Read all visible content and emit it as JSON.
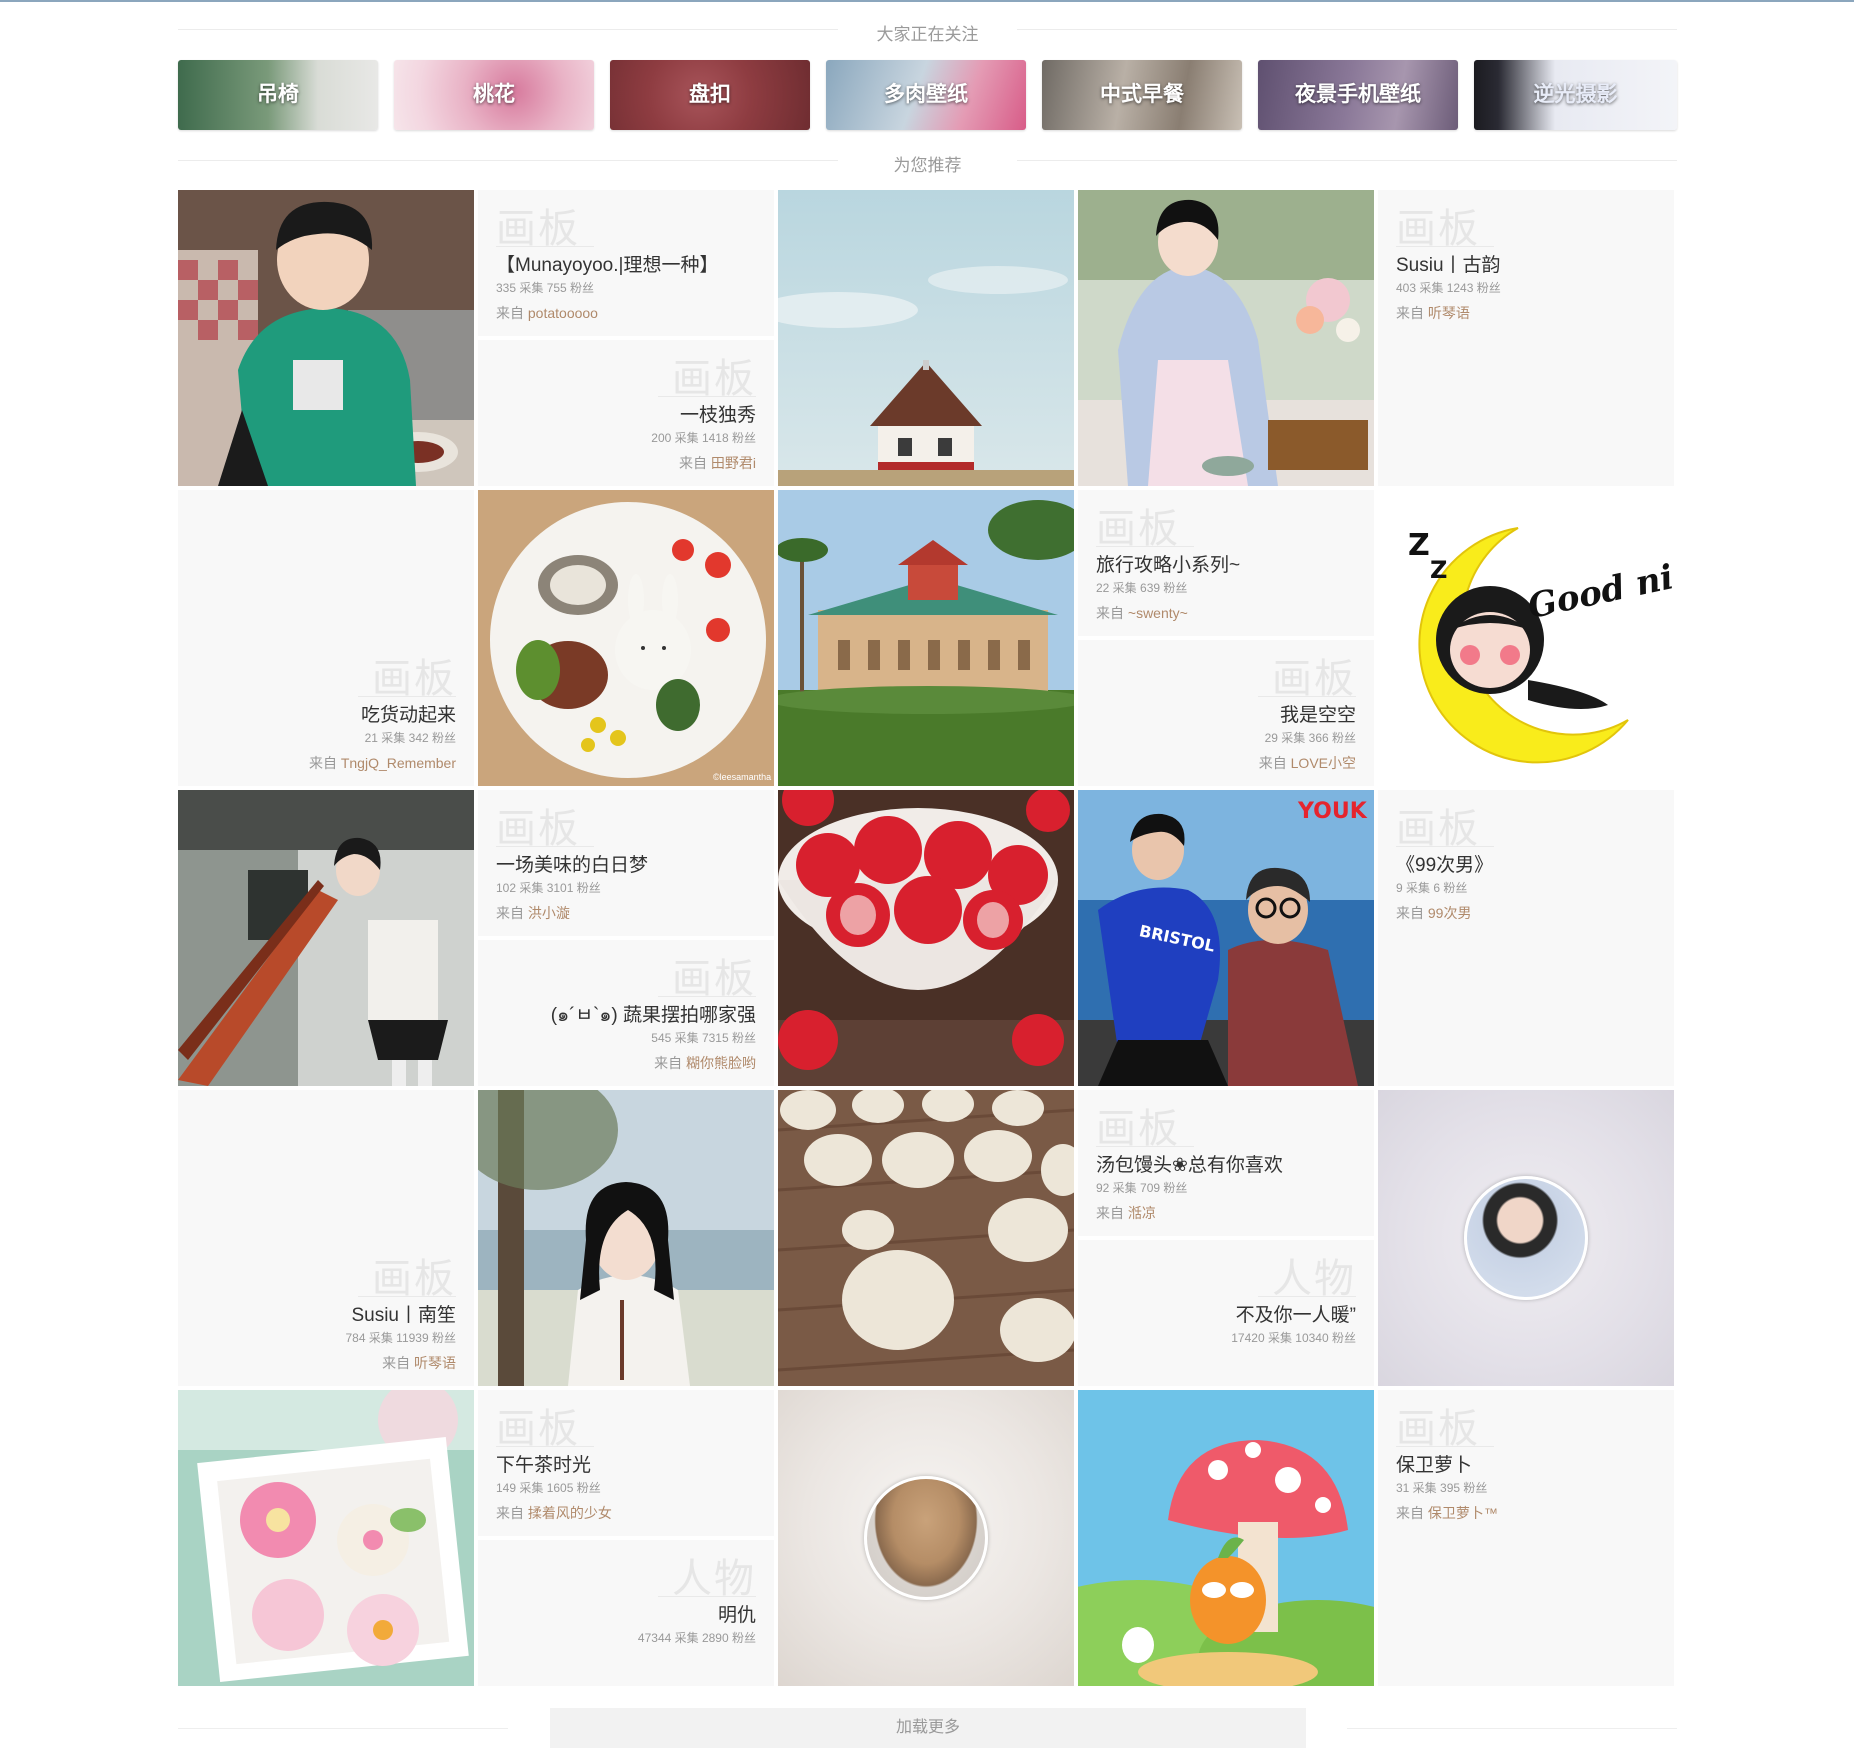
{
  "following_title": "大家正在关注",
  "recommend_title": "为您推荐",
  "load_more": "加载更多",
  "tags": [
    {
      "label": "吊椅"
    },
    {
      "label": "桃花"
    },
    {
      "label": "盘扣"
    },
    {
      "label": "多肉壁纸"
    },
    {
      "label": "中式早餐"
    },
    {
      "label": "夜景手机壁纸"
    },
    {
      "label": "逆光摄影"
    }
  ],
  "watermarks": {
    "board": "画板",
    "person": "人物"
  },
  "from_label": "来自",
  "boards": {
    "munayoyoo": {
      "title": "【Munayoyoo.|理想一种】",
      "stats": "335 采集    755 粉丝",
      "user": "potatooooo"
    },
    "yizhi": {
      "title": "一枝独秀",
      "stats": "200 采集    1418 粉丝",
      "user": "田野君i"
    },
    "susiu_gu": {
      "title": "Susiu丨古韵",
      "stats": "403 采集    1243 粉丝",
      "user": "听琴语"
    },
    "chihuo": {
      "title": "吃货动起来",
      "stats": "21 采集    342 粉丝",
      "user": "TngjQ_Remember"
    },
    "lvxing": {
      "title": "旅行攻略小系列~",
      "stats": "22 采集    639 粉丝",
      "user": "~swenty~"
    },
    "kongkong": {
      "title": "我是空空",
      "stats": "29 采集    366 粉丝",
      "user": "LOVE小空"
    },
    "baiyi": {
      "title": "一场美味的白日梦",
      "stats": "102 采集    3101 粉丝",
      "user": "洪小漩"
    },
    "shuguo": {
      "title": "(๑´ㅂ`๑) 蔬果摆拍哪家强",
      "stats": "545 采集    7315 粉丝",
      "user": "糊你熊脸哟"
    },
    "99ci": {
      "title": "《99次男》",
      "stats": "9 采集    6 粉丝",
      "user": "99次男"
    },
    "susiu_nan": {
      "title": "Susiu丨南笙",
      "stats": "784 采集    11939 粉丝",
      "user": "听琴语"
    },
    "tangbao": {
      "title": "汤包馒头❀总有你喜欢",
      "stats": "92 采集    709 粉丝",
      "user": "湉凉"
    },
    "xiawu": {
      "title": "下午茶时光",
      "stats": "149 采集    1605 粉丝",
      "user": "揉着风的少女"
    },
    "baowei": {
      "title": "保卫萝卜",
      "stats": "31 采集    395 粉丝",
      "user": "保卫萝卜™"
    }
  },
  "people": {
    "bujini": {
      "name": "不及你一人暖”",
      "stats": "17420 采集    10340 粉丝"
    },
    "mingchou": {
      "name": "明仇",
      "stats": "47344 采集    2890 粉丝"
    }
  },
  "images": {
    "goodnight_text": "Good night",
    "youku_text": "YOUK",
    "bristol_text": "BRISTOL",
    "credit": "©leesamantha"
  }
}
